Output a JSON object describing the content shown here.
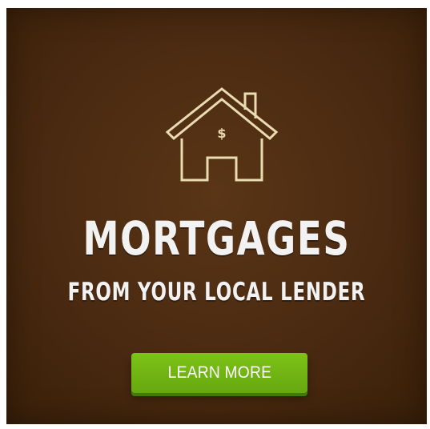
{
  "ad": {
    "icon": "house-dollar-icon",
    "title": "MORTGAGES",
    "subtitle": "FROM YOUR LOCAL LENDER",
    "cta_label": "LEARN MORE",
    "colors": {
      "background": "#4a2a11",
      "icon_stroke": "#eadcb2",
      "text": "#f2f2f2",
      "button": "#72b513",
      "button_shadow": "#3f7a0b"
    }
  }
}
